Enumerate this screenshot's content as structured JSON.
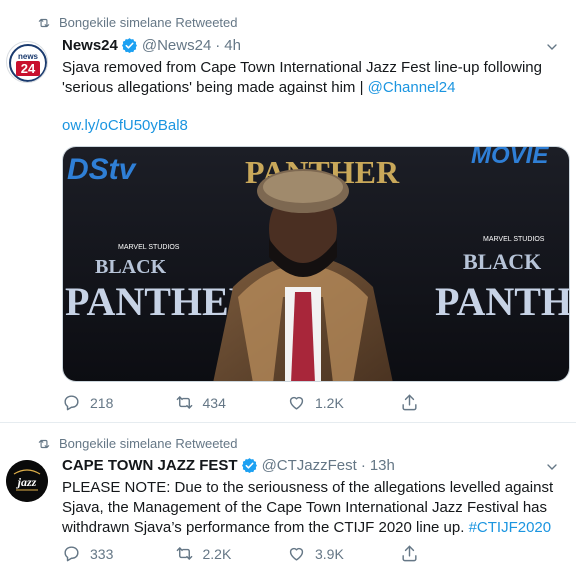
{
  "tweets": [
    {
      "retweeted_by": "Bongekile simelane Retweeted",
      "author_name": "News24",
      "author_handle": "@News24",
      "separator": "·",
      "time": "4h",
      "avatar_text": "news 24",
      "text": "Sjava removed from Cape Town International Jazz Fest line-up following 'serious allegations' being made against him | ",
      "mention": "@Channel24",
      "short_link": "ow.ly/oCfU50yBal8",
      "media": {
        "backdrop_top_left": "DStv",
        "backdrop_top_center": "PANTHER",
        "backdrop_top_right": "MOVIE",
        "poster_left_studio": "MARVEL STUDIOS",
        "poster_left_line1": "BLACK",
        "poster_left_line2": "PANTHER",
        "poster_right_studio": "MARVEL STUDIOS",
        "poster_right_line1": "BLACK",
        "poster_right_line2": "PANTHER"
      },
      "replies": "218",
      "retweets": "434",
      "likes": "1.2K"
    },
    {
      "retweeted_by": "Bongekile simelane Retweeted",
      "author_name": "CAPE TOWN JAZZ FEST",
      "author_handle": "@CTJazzFest",
      "separator": "·",
      "time": "13h",
      "avatar_text": "jazz",
      "text": "PLEASE NOTE: Due to the seriousness of the allegations levelled against Sjava, the Management of the Cape Town International Jazz Festival has withdrawn Sjava’s performance from the CTIJF 2020 line up. ",
      "hashtag": "#CTIJF2020",
      "replies": "333",
      "retweets": "2.2K",
      "likes": "3.9K"
    }
  ],
  "colors": {
    "link": "#1b95e0",
    "secondary": "#657786",
    "verified": "#1da1f2",
    "news24_red": "#c8102e"
  }
}
